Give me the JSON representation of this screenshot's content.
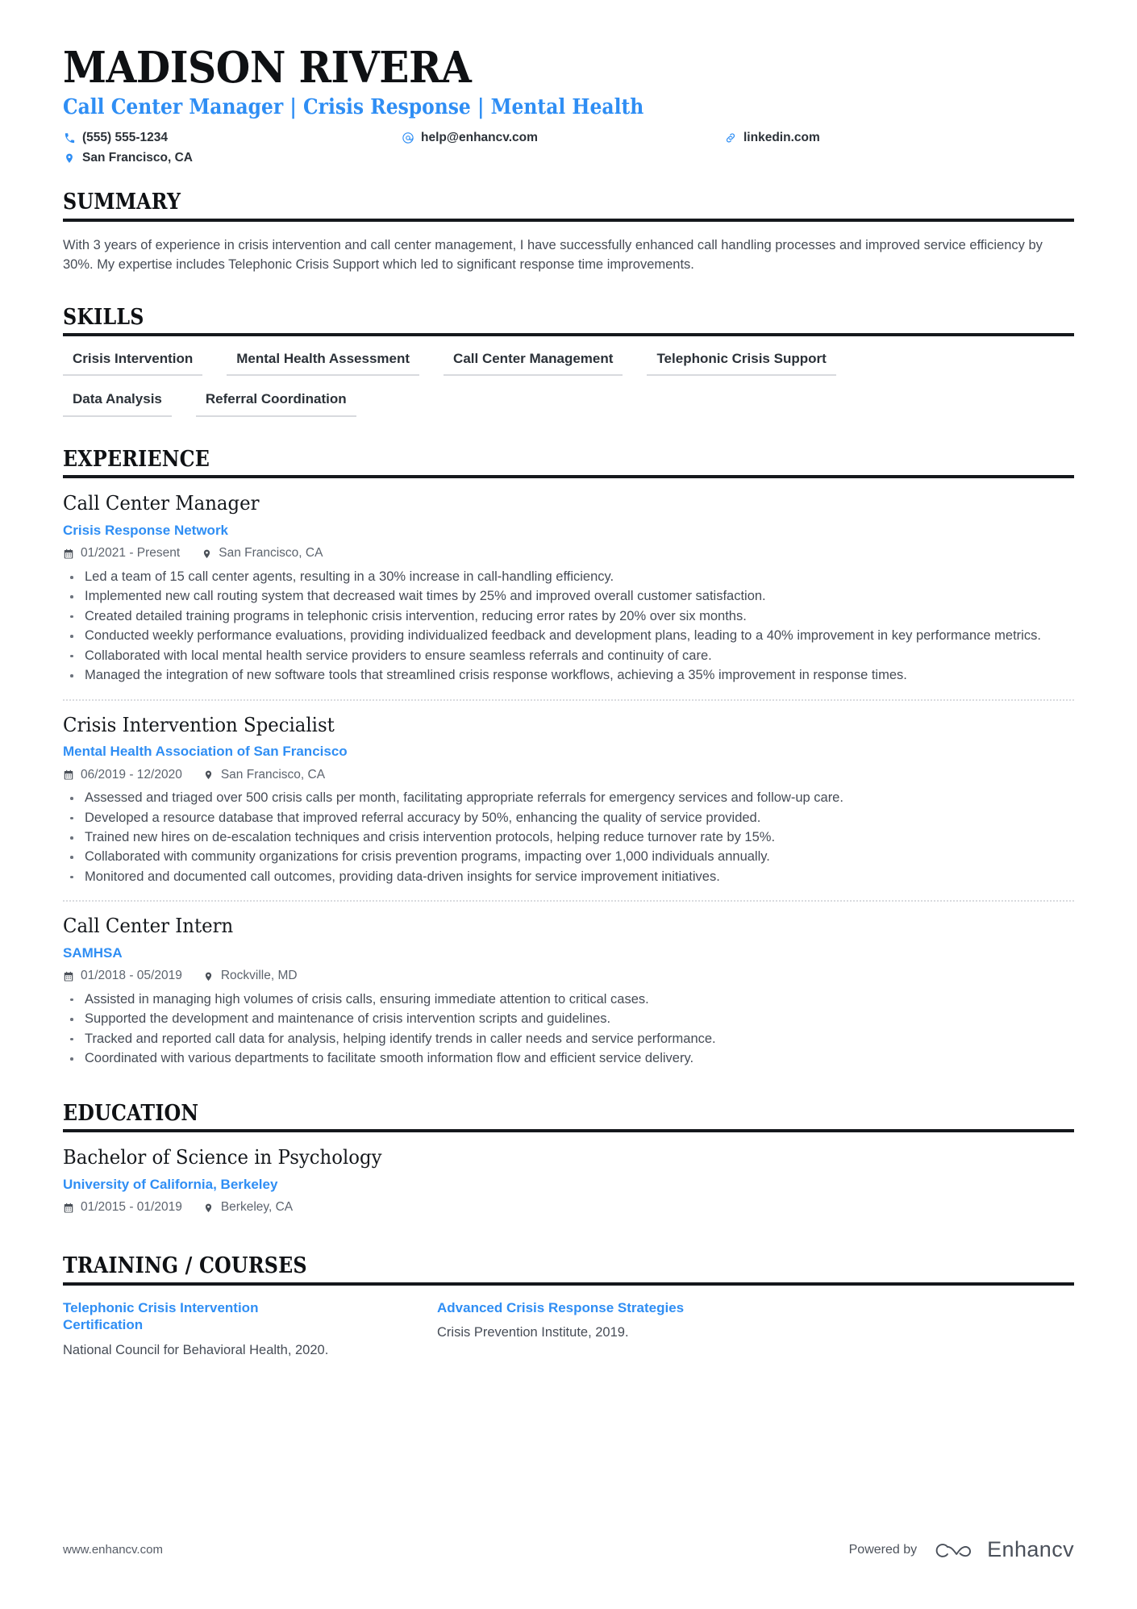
{
  "header": {
    "name": "MADISON RIVERA",
    "tagline": "Call Center Manager | Crisis Response | Mental Health",
    "contacts": [
      {
        "icon": "phone-icon",
        "text": "(555) 555-1234"
      },
      {
        "icon": "email-icon",
        "text": "help@enhancv.com"
      },
      {
        "icon": "link-icon",
        "text": "linkedin.com"
      },
      {
        "icon": "location-icon",
        "text": "San Francisco, CA"
      }
    ]
  },
  "sections": {
    "summary": {
      "title": "SUMMARY",
      "text": "With 3 years of experience in crisis intervention and call center management, I have successfully enhanced call handling processes and improved service efficiency by 30%. My expertise includes Telephonic Crisis Support which led to significant response time improvements."
    },
    "skills": {
      "title": "SKILLS",
      "rows": [
        [
          "Crisis Intervention",
          "Mental Health Assessment",
          "Call Center Management",
          "Telephonic Crisis Support"
        ],
        [
          "Data Analysis",
          "Referral Coordination"
        ]
      ]
    },
    "experience": {
      "title": "EXPERIENCE",
      "entries": [
        {
          "title": "Call Center Manager",
          "org": "Crisis Response Network",
          "date": "01/2021 - Present",
          "location": "San Francisco, CA",
          "bullets": [
            "Led a team of 15 call center agents, resulting in a 30% increase in call-handling efficiency.",
            "Implemented new call routing system that decreased wait times by 25% and improved overall customer satisfaction.",
            "Created detailed training programs in telephonic crisis intervention, reducing error rates by 20% over six months.",
            "Conducted weekly performance evaluations, providing individualized feedback and development plans, leading to a 40% improvement in key performance metrics.",
            "Collaborated with local mental health service providers to ensure seamless referrals and continuity of care.",
            "Managed the integration of new software tools that streamlined crisis response workflows, achieving a 35% improvement in response times."
          ]
        },
        {
          "title": "Crisis Intervention Specialist",
          "org": "Mental Health Association of San Francisco",
          "date": "06/2019 - 12/2020",
          "location": "San Francisco, CA",
          "bullets": [
            "Assessed and triaged over 500 crisis calls per month, facilitating appropriate referrals for emergency services and follow-up care.",
            "Developed a resource database that improved referral accuracy by 50%, enhancing the quality of service provided.",
            "Trained new hires on de-escalation techniques and crisis intervention protocols, helping reduce turnover rate by 15%.",
            "Collaborated with community organizations for crisis prevention programs, impacting over 1,000 individuals annually.",
            "Monitored and documented call outcomes, providing data-driven insights for service improvement initiatives."
          ]
        },
        {
          "title": "Call Center Intern",
          "org": "SAMHSA",
          "date": "01/2018 - 05/2019",
          "location": "Rockville, MD",
          "bullets": [
            "Assisted in managing high volumes of crisis calls, ensuring immediate attention to critical cases.",
            "Supported the development and maintenance of crisis intervention scripts and guidelines.",
            "Tracked and reported call data for analysis, helping identify trends in caller needs and service performance.",
            "Coordinated with various departments to facilitate smooth information flow and efficient service delivery."
          ]
        }
      ]
    },
    "education": {
      "title": "EDUCATION",
      "entries": [
        {
          "title": "Bachelor of Science in Psychology",
          "org": "University of California, Berkeley",
          "date": "01/2015 - 01/2019",
          "location": "Berkeley, CA"
        }
      ]
    },
    "training": {
      "title": "TRAINING / COURSES",
      "items": [
        {
          "name": "Telephonic Crisis Intervention Certification",
          "desc": "National Council for Behavioral Health, 2020."
        },
        {
          "name": "Advanced Crisis Response Strategies",
          "desc": "Crisis Prevention Institute, 2019."
        }
      ]
    }
  },
  "footer": {
    "url": "www.enhancv.com",
    "powered_by": "Powered by",
    "brand": "Enhancv"
  },
  "colors": {
    "accent": "#2f8ef4",
    "text": "#464c56",
    "heading": "#0f1114",
    "rule": "#15181c"
  }
}
